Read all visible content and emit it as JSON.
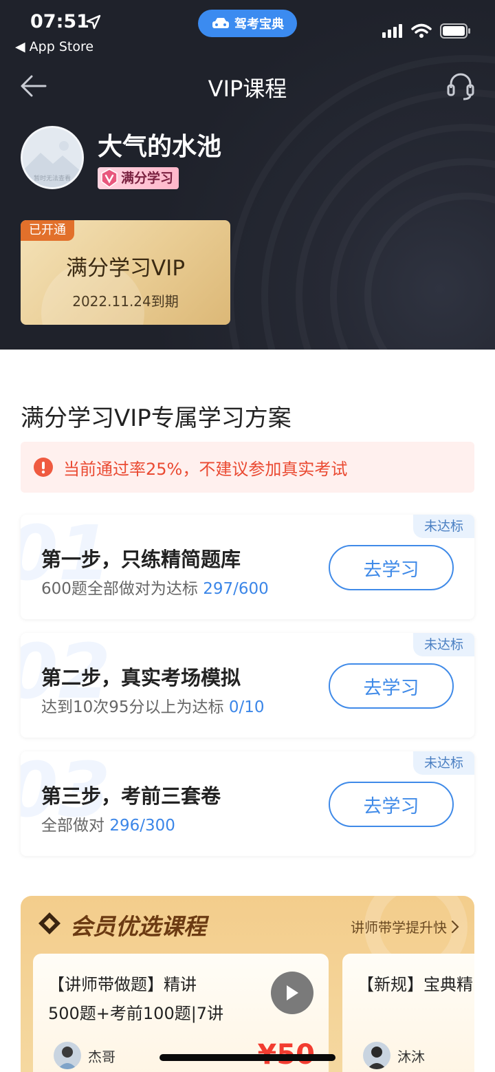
{
  "status_bar": {
    "time": "07:51",
    "back_app": "App Store",
    "app_badge": "驾考宝典"
  },
  "nav": {
    "title": "VIP课程"
  },
  "profile": {
    "avatar_caption": "暂时无法查看",
    "name": "大气的水池",
    "vip_tag": "满分学习"
  },
  "vip_card": {
    "status": "已开通",
    "title": "满分学习VIP",
    "expiry": "2022.11.24到期"
  },
  "plan": {
    "title": "满分学习VIP专属学习方案",
    "alert": "当前通过率25%，不建议参加真实考试",
    "steps": [
      {
        "num": "01",
        "badge": "未达标",
        "title": "第一步，只练精简题库",
        "desc": "600题全部做对为达标",
        "progress": "297/600",
        "button": "去学习"
      },
      {
        "num": "02",
        "badge": "未达标",
        "title": "第二步，真实考场模拟",
        "desc": "达到10次95分以上为达标",
        "progress": "0/10",
        "button": "去学习"
      },
      {
        "num": "03",
        "badge": "未达标",
        "title": "第三步，考前三套卷",
        "desc": "全部做对",
        "progress": "296/300",
        "button": "去学习"
      }
    ]
  },
  "member": {
    "title": "会员优选课程",
    "link": "讲师带学提升快",
    "courses": [
      {
        "title_line1": "【讲师带做题】精讲",
        "title_line2": "500题+考前100题|7讲",
        "teacher": "杰哥",
        "price": "¥50"
      },
      {
        "title_line1": "【新规】宝典精",
        "title_line2": "",
        "teacher": "沐沐",
        "price": ""
      }
    ]
  },
  "colors": {
    "accent_blue": "#3f8ae8",
    "alert_red": "#ea4a32",
    "vip_orange": "#e2702b",
    "header_dark": "#22252e"
  }
}
